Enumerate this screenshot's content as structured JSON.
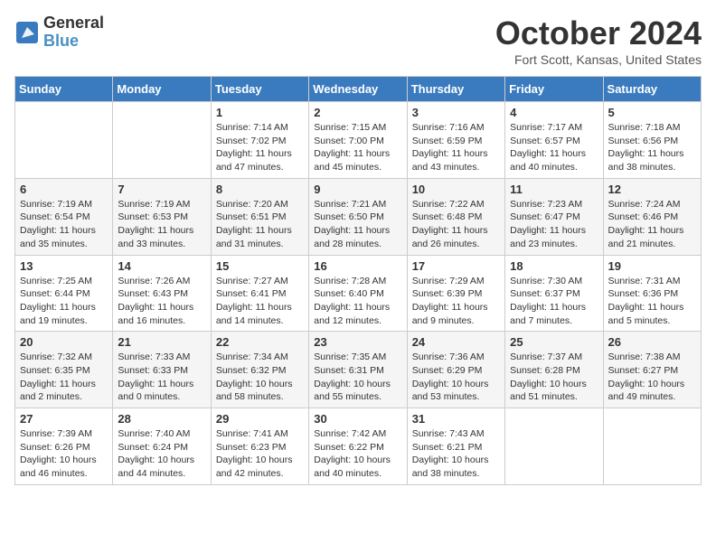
{
  "header": {
    "logo_line1": "General",
    "logo_line2": "Blue",
    "month": "October 2024",
    "location": "Fort Scott, Kansas, United States"
  },
  "days_of_week": [
    "Sunday",
    "Monday",
    "Tuesday",
    "Wednesday",
    "Thursday",
    "Friday",
    "Saturday"
  ],
  "weeks": [
    [
      {
        "day": "",
        "info": ""
      },
      {
        "day": "",
        "info": ""
      },
      {
        "day": "1",
        "info": "Sunrise: 7:14 AM\nSunset: 7:02 PM\nDaylight: 11 hours and 47 minutes."
      },
      {
        "day": "2",
        "info": "Sunrise: 7:15 AM\nSunset: 7:00 PM\nDaylight: 11 hours and 45 minutes."
      },
      {
        "day": "3",
        "info": "Sunrise: 7:16 AM\nSunset: 6:59 PM\nDaylight: 11 hours and 43 minutes."
      },
      {
        "day": "4",
        "info": "Sunrise: 7:17 AM\nSunset: 6:57 PM\nDaylight: 11 hours and 40 minutes."
      },
      {
        "day": "5",
        "info": "Sunrise: 7:18 AM\nSunset: 6:56 PM\nDaylight: 11 hours and 38 minutes."
      }
    ],
    [
      {
        "day": "6",
        "info": "Sunrise: 7:19 AM\nSunset: 6:54 PM\nDaylight: 11 hours and 35 minutes."
      },
      {
        "day": "7",
        "info": "Sunrise: 7:19 AM\nSunset: 6:53 PM\nDaylight: 11 hours and 33 minutes."
      },
      {
        "day": "8",
        "info": "Sunrise: 7:20 AM\nSunset: 6:51 PM\nDaylight: 11 hours and 31 minutes."
      },
      {
        "day": "9",
        "info": "Sunrise: 7:21 AM\nSunset: 6:50 PM\nDaylight: 11 hours and 28 minutes."
      },
      {
        "day": "10",
        "info": "Sunrise: 7:22 AM\nSunset: 6:48 PM\nDaylight: 11 hours and 26 minutes."
      },
      {
        "day": "11",
        "info": "Sunrise: 7:23 AM\nSunset: 6:47 PM\nDaylight: 11 hours and 23 minutes."
      },
      {
        "day": "12",
        "info": "Sunrise: 7:24 AM\nSunset: 6:46 PM\nDaylight: 11 hours and 21 minutes."
      }
    ],
    [
      {
        "day": "13",
        "info": "Sunrise: 7:25 AM\nSunset: 6:44 PM\nDaylight: 11 hours and 19 minutes."
      },
      {
        "day": "14",
        "info": "Sunrise: 7:26 AM\nSunset: 6:43 PM\nDaylight: 11 hours and 16 minutes."
      },
      {
        "day": "15",
        "info": "Sunrise: 7:27 AM\nSunset: 6:41 PM\nDaylight: 11 hours and 14 minutes."
      },
      {
        "day": "16",
        "info": "Sunrise: 7:28 AM\nSunset: 6:40 PM\nDaylight: 11 hours and 12 minutes."
      },
      {
        "day": "17",
        "info": "Sunrise: 7:29 AM\nSunset: 6:39 PM\nDaylight: 11 hours and 9 minutes."
      },
      {
        "day": "18",
        "info": "Sunrise: 7:30 AM\nSunset: 6:37 PM\nDaylight: 11 hours and 7 minutes."
      },
      {
        "day": "19",
        "info": "Sunrise: 7:31 AM\nSunset: 6:36 PM\nDaylight: 11 hours and 5 minutes."
      }
    ],
    [
      {
        "day": "20",
        "info": "Sunrise: 7:32 AM\nSunset: 6:35 PM\nDaylight: 11 hours and 2 minutes."
      },
      {
        "day": "21",
        "info": "Sunrise: 7:33 AM\nSunset: 6:33 PM\nDaylight: 11 hours and 0 minutes."
      },
      {
        "day": "22",
        "info": "Sunrise: 7:34 AM\nSunset: 6:32 PM\nDaylight: 10 hours and 58 minutes."
      },
      {
        "day": "23",
        "info": "Sunrise: 7:35 AM\nSunset: 6:31 PM\nDaylight: 10 hours and 55 minutes."
      },
      {
        "day": "24",
        "info": "Sunrise: 7:36 AM\nSunset: 6:29 PM\nDaylight: 10 hours and 53 minutes."
      },
      {
        "day": "25",
        "info": "Sunrise: 7:37 AM\nSunset: 6:28 PM\nDaylight: 10 hours and 51 minutes."
      },
      {
        "day": "26",
        "info": "Sunrise: 7:38 AM\nSunset: 6:27 PM\nDaylight: 10 hours and 49 minutes."
      }
    ],
    [
      {
        "day": "27",
        "info": "Sunrise: 7:39 AM\nSunset: 6:26 PM\nDaylight: 10 hours and 46 minutes."
      },
      {
        "day": "28",
        "info": "Sunrise: 7:40 AM\nSunset: 6:24 PM\nDaylight: 10 hours and 44 minutes."
      },
      {
        "day": "29",
        "info": "Sunrise: 7:41 AM\nSunset: 6:23 PM\nDaylight: 10 hours and 42 minutes."
      },
      {
        "day": "30",
        "info": "Sunrise: 7:42 AM\nSunset: 6:22 PM\nDaylight: 10 hours and 40 minutes."
      },
      {
        "day": "31",
        "info": "Sunrise: 7:43 AM\nSunset: 6:21 PM\nDaylight: 10 hours and 38 minutes."
      },
      {
        "day": "",
        "info": ""
      },
      {
        "day": "",
        "info": ""
      }
    ]
  ]
}
